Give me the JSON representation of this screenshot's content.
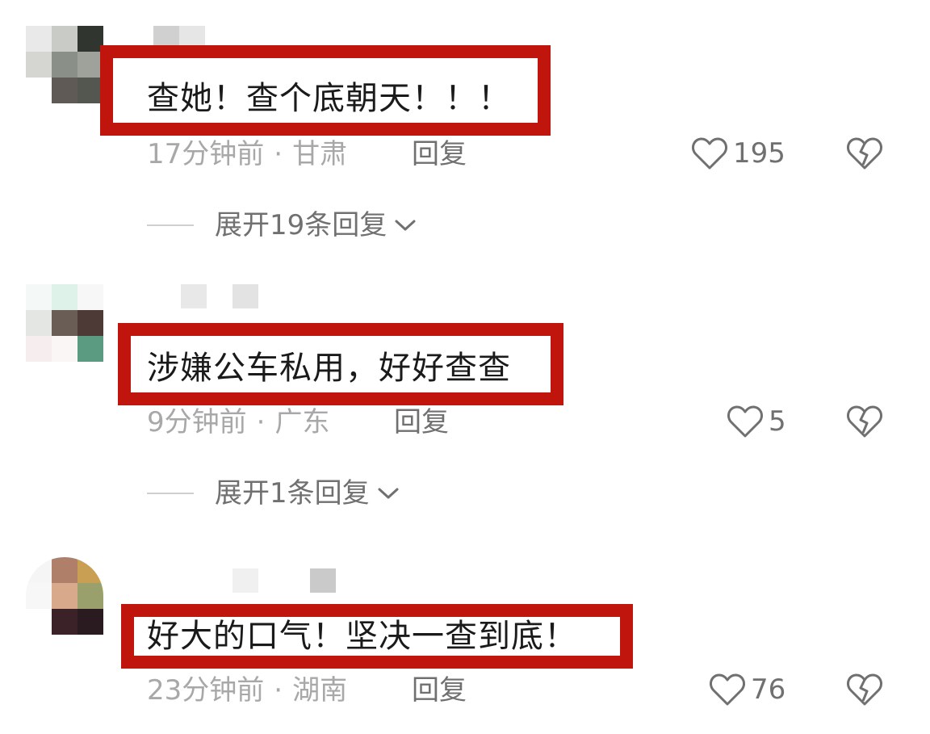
{
  "comments": [
    {
      "text": "查她！查个底朝天！！！",
      "time": "17分钟前",
      "location": "甘肃",
      "reply_label": "回复",
      "likes": "195",
      "expand_label": "展开19条回复"
    },
    {
      "text": "涉嫌公车私用，好好查查",
      "time": "9分钟前",
      "location": "广东",
      "reply_label": "回复",
      "likes": "5",
      "expand_label": "展开1条回复"
    },
    {
      "text": "好大的口气！坚决一查到底！",
      "time": "23分钟前",
      "location": "湖南",
      "reply_label": "回复",
      "likes": "76"
    }
  ],
  "meta_separator": "·",
  "colors": {
    "highlight_border": "#c0150c",
    "meta_text": "#a8a8a8",
    "action_text": "#707070"
  },
  "icons": {
    "like": "heart-outline-icon",
    "dislike": "broken-heart-icon",
    "expand": "chevron-down-icon"
  }
}
